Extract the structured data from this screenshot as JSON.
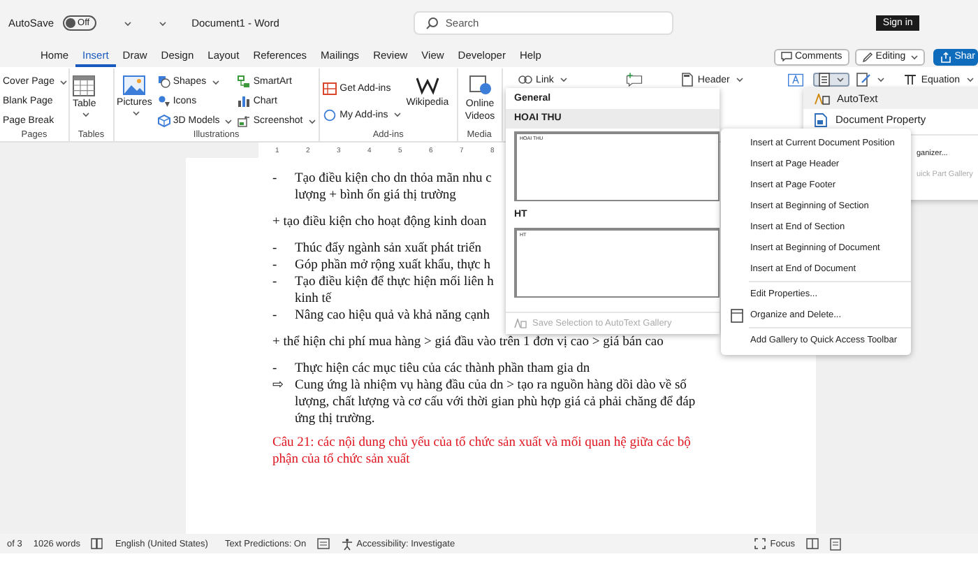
{
  "title_bar": {
    "autosave_label": "AutoSave",
    "autosave": {
      "on": false,
      "label": "Off"
    },
    "document_title": "Document1 - Word",
    "search": {
      "placeholder": "Search"
    },
    "sign_in": "Sign in"
  },
  "ribbon_tabs": [
    {
      "label": "Home",
      "selected": false
    },
    {
      "label": "Insert",
      "selected": true
    },
    {
      "label": "Draw",
      "selected": false
    },
    {
      "label": "Design",
      "selected": false
    },
    {
      "label": "Layout",
      "selected": false
    },
    {
      "label": "References",
      "selected": false
    },
    {
      "label": "Mailings",
      "selected": false
    },
    {
      "label": "Review",
      "selected": false
    },
    {
      "label": "View",
      "selected": false
    },
    {
      "label": "Developer",
      "selected": false
    },
    {
      "label": "Help",
      "selected": false
    }
  ],
  "ribbon_actions": [
    {
      "kind": "comments",
      "label": "Comments",
      "dropdown": false
    },
    {
      "kind": "editing",
      "label": "Editing",
      "dropdown": true
    },
    {
      "kind": "share",
      "label": "Shar",
      "dropdown": false
    }
  ],
  "ribbon_groups": [
    {
      "label": "Pages",
      "commands": [
        {
          "label": "Cover Page",
          "dropdown": true
        },
        {
          "label": "Blank Page",
          "dropdown": false
        },
        {
          "label": "Page Break",
          "dropdown": false
        }
      ]
    },
    {
      "label": "Tables",
      "commands": [
        {
          "label": "Table",
          "dropdown": true
        }
      ]
    },
    {
      "label": "Illustrations",
      "commands": [
        {
          "label": "Pictures",
          "dropdown": true
        },
        {
          "label": "Shapes",
          "dropdown": true
        },
        {
          "label": "Icons",
          "dropdown": false
        },
        {
          "label": "3D Models",
          "dropdown": true
        },
        {
          "label": "SmartArt",
          "dropdown": false
        },
        {
          "label": "Chart",
          "dropdown": false
        },
        {
          "label": "Screenshot",
          "dropdown": true
        }
      ]
    },
    {
      "label": "Add-ins",
      "commands": [
        {
          "label": "Get Add-ins",
          "dropdown": false
        },
        {
          "label": "My Add-ins",
          "dropdown": true
        },
        {
          "label": "Wikipedia",
          "dropdown": false
        }
      ]
    },
    {
      "label": "Media",
      "commands": [
        {
          "label": "Online Videos",
          "dropdown": false
        }
      ]
    }
  ],
  "ribbon_more": [
    {
      "kind": "link",
      "label": "Link",
      "dropdown": true,
      "selected": false
    },
    {
      "kind": "comment",
      "dropdown": false,
      "selected": false
    },
    {
      "kind": "header",
      "label": "Header",
      "dropdown": true,
      "selected": false
    },
    {
      "kind": "textbox",
      "dropdown": false,
      "selected": false
    },
    {
      "kind": "quick_parts",
      "dropdown": true,
      "selected": true
    },
    {
      "kind": "signature",
      "dropdown": true,
      "selected": false
    },
    {
      "kind": "equation",
      "label": "Equation",
      "dropdown": true,
      "selected": false
    }
  ],
  "ruler": {
    "numbers": [
      "1",
      "2",
      "3",
      "4",
      "5",
      "6",
      "7",
      "8"
    ]
  },
  "document": {
    "paragraphs": [
      {
        "kind": "list",
        "marker": "-",
        "lines": [
          "Tạo điều kiện cho dn thỏa mãn nhu c",
          "lượng + bình ổn giá thị trường"
        ]
      },
      {
        "kind": "plain",
        "lines": [
          "+ tạo điều kiện cho hoạt động kinh doan"
        ]
      },
      {
        "kind": "list",
        "marker": "-",
        "lines": [
          "Thúc đẩy ngành sản xuất phát triển"
        ]
      },
      {
        "kind": "list",
        "marker": "-",
        "lines": [
          "Góp phần mở rộng xuất khẩu, thực h"
        ]
      },
      {
        "kind": "list",
        "marker": "-",
        "lines": [
          "Tạo điều kiện để thực hiện mối liên h",
          "kinh tế"
        ]
      },
      {
        "kind": "list",
        "marker": "-",
        "lines": [
          "Nâng cao hiệu quả và khả năng cạnh"
        ]
      },
      {
        "kind": "plain",
        "lines": [
          "+ thể hiện chi phí mua hàng > giá đầu vào trên 1 đơn vị cao > giá bán cao"
        ]
      },
      {
        "kind": "list",
        "marker": "-",
        "lines": [
          "Thực hiện các mục tiêu của các thành phần tham gia dn"
        ]
      },
      {
        "kind": "list",
        "marker": "⇨",
        "lines": [
          "Cung ứng là nhiệm vụ hàng đầu của dn > tạo ra nguồn hàng dồi dào về số",
          "lượng, chất lượng và cơ cấu với thời gian phù hợp giá cả phải chăng để đáp",
          "ứng thị trường."
        ]
      },
      {
        "kind": "heading",
        "lines": [
          "Câu 21: các nội dung chủ yếu của tổ chức sản xuất và mối quan hệ giữa các bộ",
          "phận của tổ chức sản xuất"
        ]
      }
    ]
  },
  "autotext_gallery": {
    "category": "General",
    "entries": [
      {
        "name": "HOAI THU",
        "preview": "HOAI THU",
        "selected": true
      },
      {
        "name": "HT",
        "preview": "HT",
        "selected": false
      }
    ],
    "footer": {
      "label": "Save Selection to AutoText Gallery",
      "disabled": true
    }
  },
  "quick_parts_menu": {
    "items": [
      {
        "kind": "autotext",
        "label": "AutoText",
        "selected": true,
        "disabled": false
      },
      {
        "kind": "property",
        "label": "Document Property",
        "selected": false,
        "disabled": false
      },
      {
        "kind": "plain",
        "label": "ganizer...",
        "selected": false,
        "disabled": false
      },
      {
        "kind": "plain",
        "label": "uick Part Gallery",
        "selected": false,
        "disabled": true
      }
    ]
  },
  "context_menu": {
    "sections": [
      [
        {
          "kind": "plain",
          "label": "Insert at Current Document Position"
        },
        {
          "kind": "plain",
          "label": "Insert at Page Header"
        },
        {
          "kind": "plain",
          "label": "Insert at Page Footer"
        },
        {
          "kind": "plain",
          "label": "Insert at Beginning of Section"
        },
        {
          "kind": "plain",
          "label": "Insert at End of Section"
        },
        {
          "kind": "plain",
          "label": "Insert at Beginning of Document"
        },
        {
          "kind": "plain",
          "label": "Insert at End of Document"
        }
      ],
      [
        {
          "kind": "plain",
          "label": "Edit Properties..."
        },
        {
          "kind": "organize",
          "label": "Organize and Delete..."
        }
      ],
      [
        {
          "kind": "plain",
          "label": "Add Gallery to Quick Access Toolbar"
        }
      ]
    ]
  },
  "status_bar": {
    "page": "of 3",
    "words": "1026 words",
    "language": "English (United States)",
    "text_predictions": "Text Predictions: On",
    "accessibility": "Accessibility: Investigate",
    "focus": "Focus"
  }
}
